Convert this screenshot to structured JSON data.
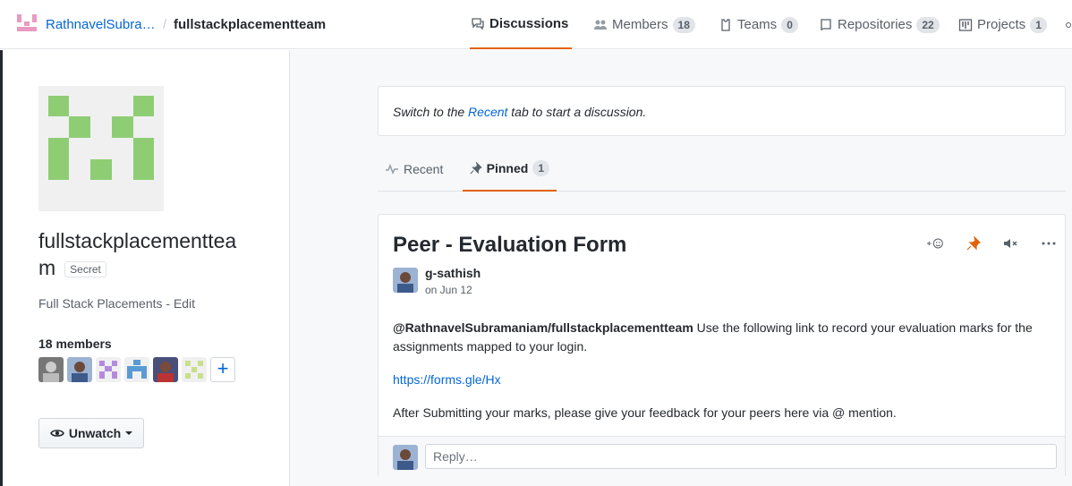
{
  "header": {
    "org_name": "RathnavelSubra…",
    "separator": "/",
    "team_name": "fullstackplacementteam",
    "tabs": [
      {
        "label": "Discussions",
        "count": null,
        "icon": "comment-discussion-icon"
      },
      {
        "label": "Members",
        "count": "18",
        "icon": "people-icon"
      },
      {
        "label": "Teams",
        "count": "0",
        "icon": "jersey-icon"
      },
      {
        "label": "Repositories",
        "count": "22",
        "icon": "repo-icon"
      },
      {
        "label": "Projects",
        "count": "1",
        "icon": "project-icon"
      }
    ]
  },
  "sidebar": {
    "team_name": "fullstackplacementteam",
    "badge": "Secret",
    "description": "Full Stack Placements - Edit",
    "members_label": "18 members",
    "add_member": "+",
    "unwatch_label": "Unwatch"
  },
  "main": {
    "notice": {
      "prefix": "Switch to the ",
      "link": "Recent",
      "suffix": " tab to start a discussion."
    },
    "subtabs": [
      {
        "label": "Recent",
        "count": null
      },
      {
        "label": "Pinned",
        "count": "1"
      }
    ],
    "post": {
      "title": "Peer - Evaluation Form",
      "author": "g-sathish",
      "date": "on Jun 12",
      "mention": "@RathnavelSubramaniam/fullstackplacementteam",
      "body1": " Use the following link to record your evaluation marks for the assignments mapped to your login.",
      "link": "https://forms.gle/Hx",
      "body2": "After Submitting your marks, please give your feedback for your peers here via @ mention.",
      "reply_placeholder": "Reply…"
    }
  },
  "colors": {
    "accent": "#e36209",
    "link": "#0366d6",
    "identicon": "#8fcd74"
  }
}
